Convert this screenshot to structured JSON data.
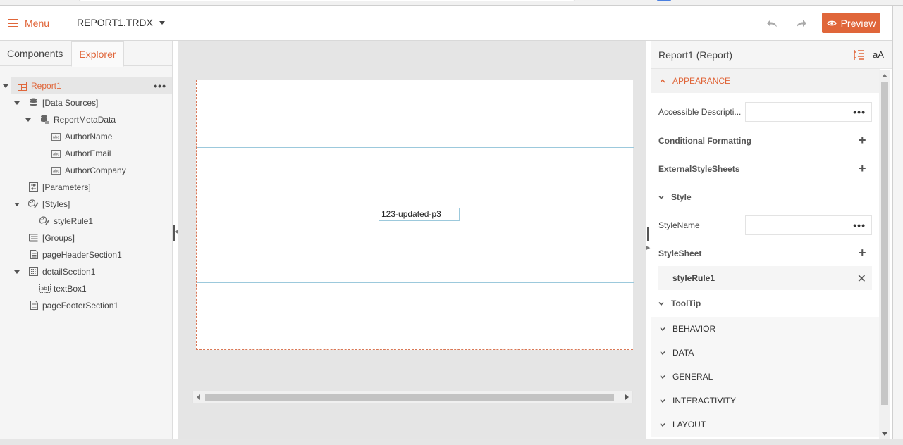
{
  "toolbar": {
    "menu_label": "Menu",
    "document_title": "REPORT1.TRDX",
    "preview_label": "Preview",
    "accent_color": "#e0663a"
  },
  "left_panel": {
    "tabs": [
      {
        "label": "Components",
        "active": false
      },
      {
        "label": "Explorer",
        "active": true
      }
    ],
    "tree": [
      {
        "label": "Report1",
        "icon": "report-icon",
        "expanded": true,
        "selected": true
      },
      {
        "label": "[Data Sources]",
        "icon": "database-icon",
        "expanded": true
      },
      {
        "label": "ReportMetaData",
        "icon": "datasource-icon",
        "expanded": true
      },
      {
        "label": "AuthorName",
        "icon": "field-icon"
      },
      {
        "label": "AuthorEmail",
        "icon": "field-icon"
      },
      {
        "label": "AuthorCompany",
        "icon": "field-icon"
      },
      {
        "label": "[Parameters]",
        "icon": "parameters-icon"
      },
      {
        "label": "[Styles]",
        "icon": "palette-icon",
        "expanded": true
      },
      {
        "label": "styleRule1",
        "icon": "palette-icon"
      },
      {
        "label": "[Groups]",
        "icon": "groups-icon"
      },
      {
        "label": "pageHeaderSection1",
        "icon": "section-icon"
      },
      {
        "label": "detailSection1",
        "icon": "detail-section-icon",
        "expanded": true
      },
      {
        "label": "textBox1",
        "icon": "textbox-icon"
      },
      {
        "label": "pageFooterSection1",
        "icon": "section-icon"
      }
    ]
  },
  "canvas": {
    "textbox_value": "123-updated-p3"
  },
  "properties": {
    "title": "Report1 (Report)",
    "font_toggle_label": "aA",
    "appearance_label": "APPEARANCE",
    "accessible_description_label": "Accessible Descripti...",
    "conditional_formatting_label": "Conditional Formatting",
    "external_stylesheets_label": "ExternalStyleSheets",
    "style_label": "Style",
    "style_name_label": "StyleName",
    "stylesheet_label": "StyleSheet",
    "stylesheet_item": "styleRule1",
    "tooltip_label": "ToolTip",
    "categories": [
      "BEHAVIOR",
      "DATA",
      "GENERAL",
      "INTERACTIVITY",
      "LAYOUT"
    ]
  }
}
